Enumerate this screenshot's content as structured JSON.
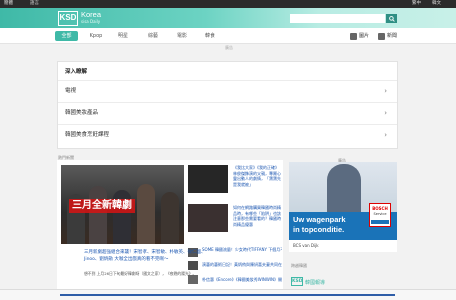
{
  "topbar": {
    "left1": "簡體",
    "left2": "語言",
    "right1": "繁中",
    "right2": "韓文"
  },
  "header": {
    "logo": "KSD",
    "logo_text": "Korea",
    "logo_sub": "sisa Daily"
  },
  "search": {
    "placeholder": ""
  },
  "nav": {
    "tabs": [
      "全部",
      "Kpop",
      "明星",
      "綜藝",
      "電影",
      "韓食"
    ],
    "active_tab": "全部",
    "tools": [
      "圖片",
      "新聞"
    ]
  },
  "ad_label": "廣告",
  "deep_panel": {
    "title": "深入瞭解",
    "items": [
      "電視",
      "韓國美妝產品",
      "韓國美食烹飪課程"
    ]
  },
  "news_section": {
    "label": "熱門新聞"
  },
  "headline": {
    "overlay": "三月全新韓劇",
    "title": "三月新劇超強組合來襲！宋智孝、宋智敏、朴敏英、徐仁國、Jinoo、劉炳勛 大咖全出戲真的看不完啊～",
    "desc": "想不到 上月26日下旬最好韓劇呀（國文之家），《夜晚的陽光》。"
  },
  "side_stories": [
    "《我比大家》《我的正確》林俊傑飾演的父親，專屬心靈出動人的劇情，「寶寶先是我就被」",
    "如何在網路購買韓國時尚精品時，有哪些「陷阱」也該注意那些需要看的？韓國時尚精品優惠",
    "SOME 韓國流量！少女時代TIFFANY 下個月不日發起結婚，高談…",
    "演藝的藝術日記！黃炳侑與陳妍喜夫妻共同在節目中揭示小家庭的…",
    "朴信惠《Encore》《韓國美妝秀WINWIN》開展影響力…"
  ],
  "side_ad": {
    "line1": "Uw wagenpark",
    "line2": "in topconditie.",
    "brand": "BOSCH",
    "brand_sub": "Service",
    "caption": "BCS van Dijk"
  },
  "side_labels": {
    "ad": "廣告",
    "bottom": "跨越韓國"
  },
  "footer": {
    "logo": "KSD",
    "text": "韓國報導"
  },
  "colors": {
    "accent": "#3fb9a7",
    "link": "#1a55b0"
  }
}
